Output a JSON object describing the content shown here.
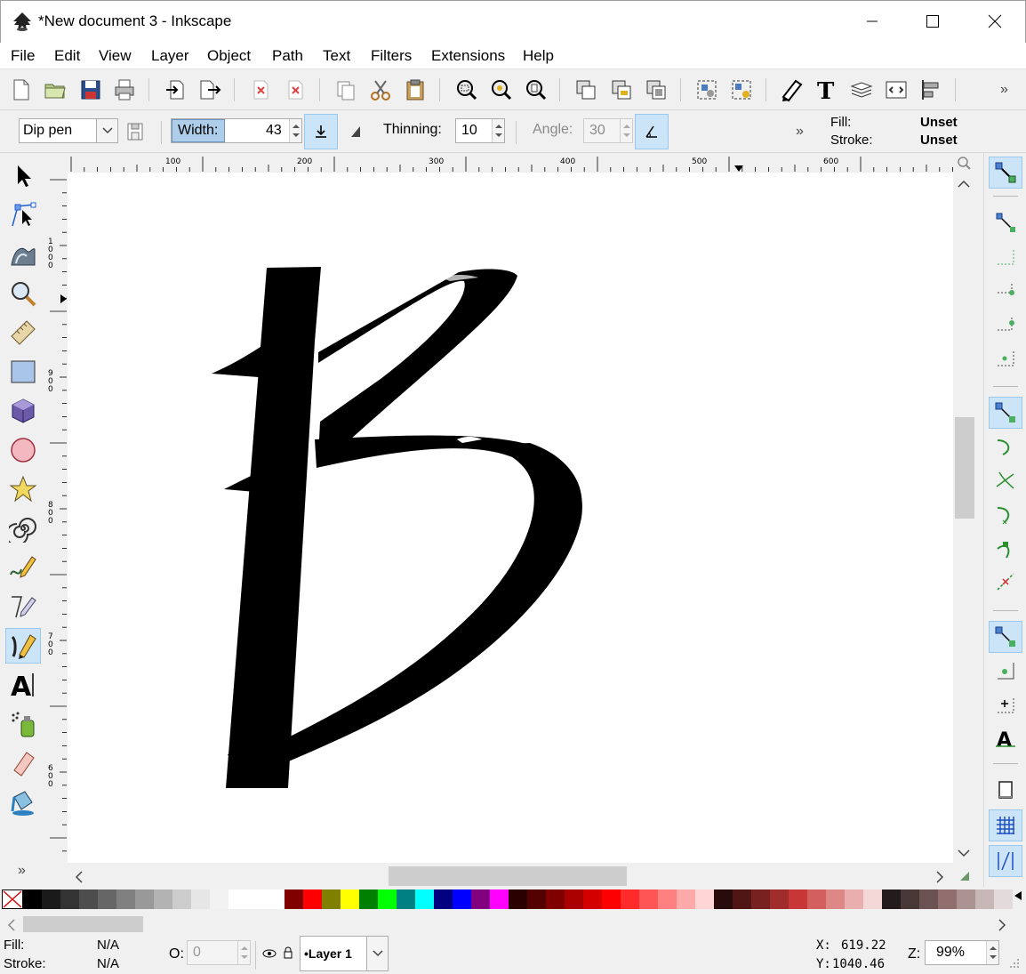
{
  "window": {
    "title": "*New document 3 - Inkscape"
  },
  "menu": [
    "File",
    "Edit",
    "View",
    "Layer",
    "Object",
    "Path",
    "Text",
    "Filters",
    "Extensions",
    "Help"
  ],
  "tool_controls": {
    "preset": "Dip pen",
    "width_label": "Width:",
    "width_value": "43",
    "thinning_label": "Thinning:",
    "thinning_value": "10",
    "angle_label": "Angle:",
    "angle_value": "30",
    "more": "»"
  },
  "style_indicator": {
    "fill_label": "Fill:",
    "fill_value": "Unset",
    "stroke_label": "Stroke:",
    "stroke_value": "Unset"
  },
  "rulers": {
    "horizontal": [
      "100",
      "200",
      "300",
      "400",
      "500",
      "600"
    ],
    "vertical": [
      "1000",
      "900",
      "800",
      "700",
      "600"
    ]
  },
  "toolbox_more": "»",
  "status": {
    "fill_label": "Fill:",
    "fill_value": "N/A",
    "stroke_label": "Stroke:",
    "stroke_value": "N/A",
    "opacity_label": "O:",
    "opacity_value": "0",
    "layer": "•Layer 1",
    "x_label": "X:",
    "x_value": "619.22",
    "y_label": "Y:",
    "y_value": "1040.46",
    "zoom_label": "Z:",
    "zoom_value": "99%"
  },
  "palette_colors": [
    "#000000",
    "#1a1a1a",
    "#333333",
    "#4d4d4d",
    "#666666",
    "#808080",
    "#999999",
    "#b3b3b3",
    "#cccccc",
    "#e6e6e6",
    "#f2f2f2",
    "#ffffff",
    "#ffffff",
    "#ffffff",
    "#800000",
    "#ff0000",
    "#808000",
    "#ffff00",
    "#008000",
    "#00ff00",
    "#008080",
    "#00ffff",
    "#000080",
    "#0000ff",
    "#800080",
    "#ff00ff",
    "#2b0000",
    "#550000",
    "#800000",
    "#aa0000",
    "#d40000",
    "#ff0000",
    "#ff2a2a",
    "#ff5555",
    "#ff8080",
    "#ffaaaa",
    "#ffd5d5",
    "#280b0b",
    "#501616",
    "#782121",
    "#a02c2c",
    "#c83737",
    "#d35f5f",
    "#de8787",
    "#e9afaf",
    "#f4d7d7",
    "#241c1c",
    "#483737",
    "#6c5353",
    "#916f6f",
    "#ac9393",
    "#c8b7b7",
    "#e3dbdb"
  ]
}
